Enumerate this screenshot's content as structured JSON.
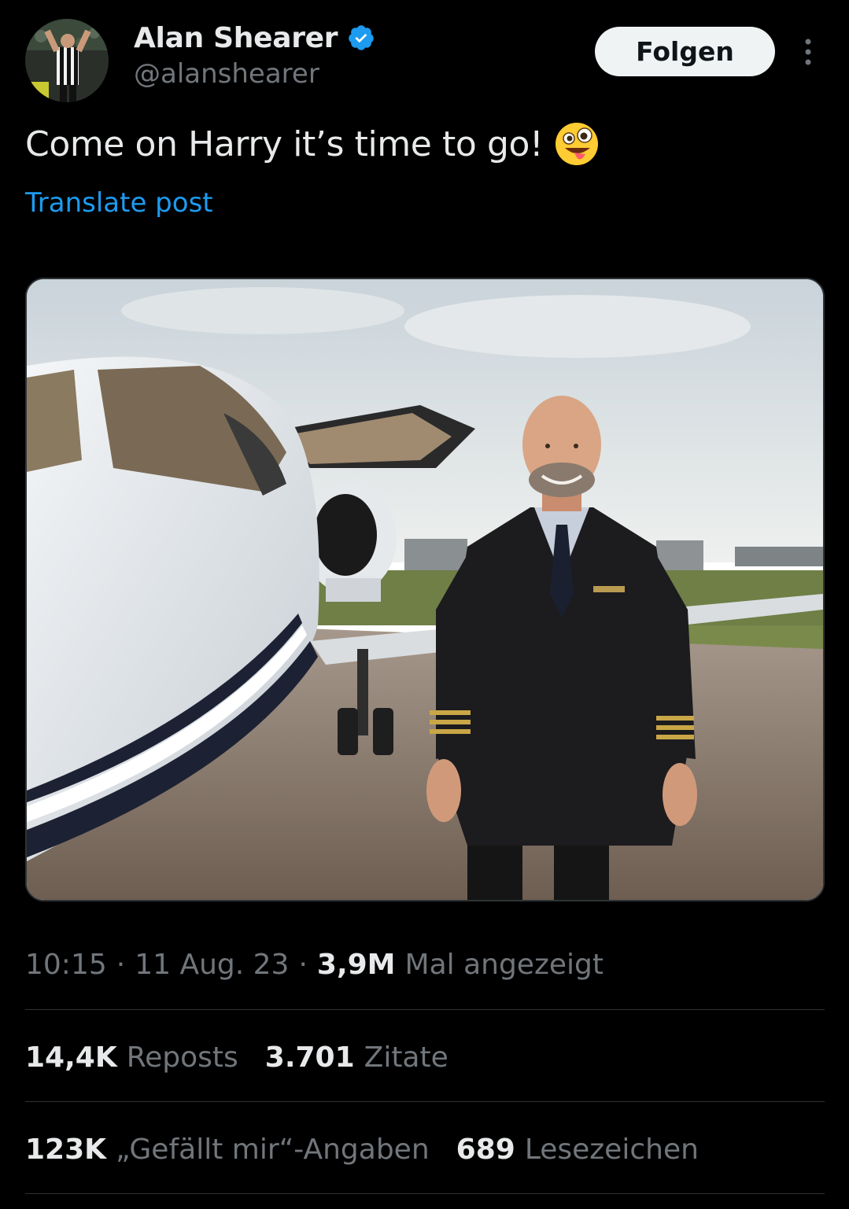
{
  "author": {
    "name": "Alan Shearer",
    "handle": "@alanshearer",
    "verified": true
  },
  "follow_label": "Folgen",
  "tweet": {
    "text": "Come on Harry it’s time to go!",
    "emoji": "zany-face-emoji",
    "translate_label": "Translate post"
  },
  "media": {
    "alt": "Photo of a man in a pilot uniform standing in front of a private jet"
  },
  "meta": {
    "time": "10:15",
    "date": "11 Aug. 23",
    "views_count": "3,9M",
    "views_label": "Mal angezeigt",
    "separator": "·"
  },
  "stats": {
    "reposts_count": "14,4K",
    "reposts_label": "Reposts",
    "quotes_count": "3.701",
    "quotes_label": "Zitate",
    "likes_count": "123K",
    "likes_label": "„Gefällt mir“-Angaben",
    "bookmarks_count": "689",
    "bookmarks_label": "Lesezeichen"
  },
  "colors": {
    "background": "#000000",
    "primary_text": "#e7e9ea",
    "secondary_text": "#71767b",
    "link": "#1d9bf0",
    "divider": "#2f3336",
    "follow_bg": "#eff3f4"
  },
  "icons": {
    "verified": "verified-badge-icon",
    "more": "more-options-icon"
  }
}
